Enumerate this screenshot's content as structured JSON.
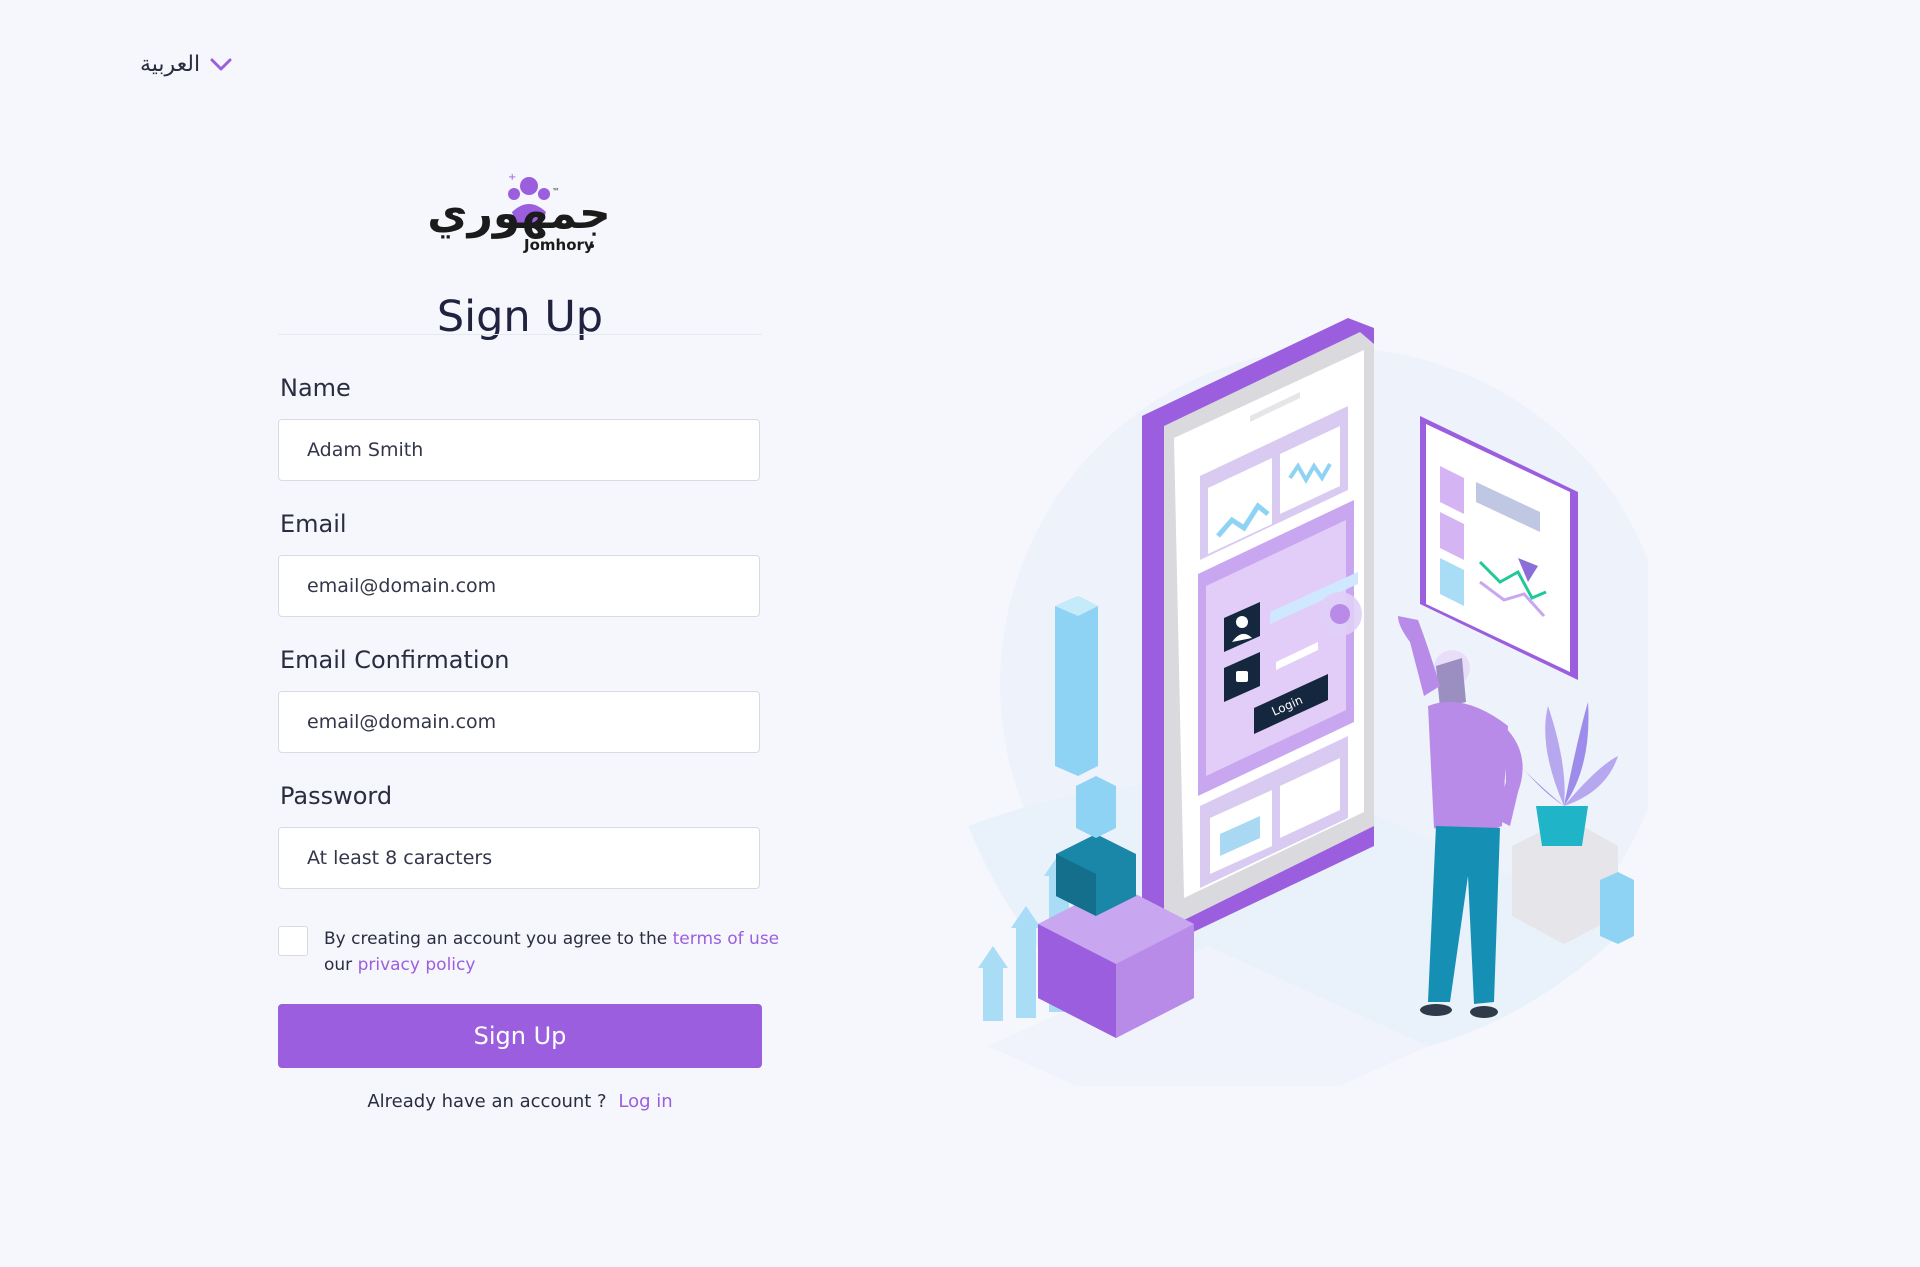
{
  "language": {
    "label": "العربية"
  },
  "logo": {
    "latin": "Jomhory",
    "arabic": "جمهوري",
    "tm": "™"
  },
  "page_title": "Sign Up",
  "form": {
    "name": {
      "label": "Name",
      "placeholder": "Adam Smith"
    },
    "email": {
      "label": "Email",
      "placeholder": "email@domain.com"
    },
    "email_confirmation": {
      "label": "Email Confirmation",
      "placeholder": "email@domain.com"
    },
    "password": {
      "label": "Password",
      "placeholder": "At least 8 caracters"
    },
    "terms": {
      "prefix": "By creating an account you agree to the",
      "terms_link": "terms of use",
      "middle": "our",
      "privacy_link": "privacy policy"
    },
    "submit_label": "Sign Up"
  },
  "footer": {
    "question": "Already have an account ?",
    "login_link": "Log in"
  },
  "illustration": {
    "login_button_text": "Login"
  },
  "colors": {
    "accent": "#9b5ede",
    "background": "#f6f7fc",
    "text": "#1f2237"
  },
  "icons": [
    "chevron-down-icon",
    "user-icon",
    "lock-icon"
  ]
}
